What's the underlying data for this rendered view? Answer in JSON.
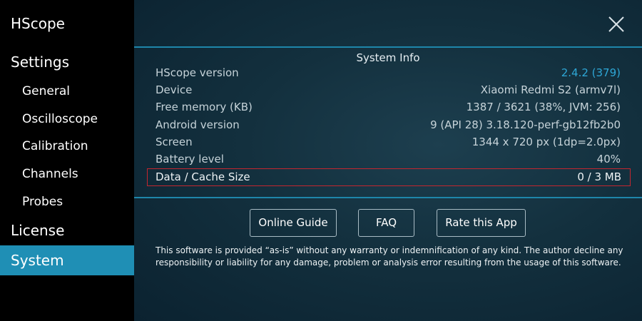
{
  "sidebar": {
    "app_title": "HScope",
    "settings_label": "Settings",
    "items": [
      {
        "label": "General"
      },
      {
        "label": "Oscilloscope"
      },
      {
        "label": "Calibration"
      },
      {
        "label": "Channels"
      },
      {
        "label": "Probes"
      }
    ],
    "license_label": "License",
    "system_label": "System",
    "selected_color": "#1f8fb5"
  },
  "main": {
    "section_title": "System Info",
    "rows": [
      {
        "key": "HScope version",
        "value": "2.4.2 (379)"
      },
      {
        "key": "Device",
        "value": "Xiaomi Redmi S2 (armv7l)"
      },
      {
        "key": "Free memory (KB)",
        "value": "1387 / 3621 (38%, JVM: 256)"
      },
      {
        "key": "Android version",
        "value": "9 (API 28) 3.18.120-perf-gb12fb2b0"
      },
      {
        "key": "Screen",
        "value": "1344 x 720 px (1dp=2.0px)"
      },
      {
        "key": "Battery level",
        "value": "40%"
      },
      {
        "key": "Data / Cache Size",
        "value": "0 / 3 MB"
      }
    ],
    "buttons": {
      "online_guide": "Online Guide",
      "faq": "FAQ",
      "rate": "Rate this App"
    },
    "disclaimer": "This software is provided “as-is” without any warranty or indemnification of any kind. The author decline any responsibility or liability for any damage, problem or analysis error resulting from the usage of this software.",
    "accent_color": "#2ea7d6",
    "highlight_color": "#c4262f",
    "close_icon": "close-icon"
  }
}
